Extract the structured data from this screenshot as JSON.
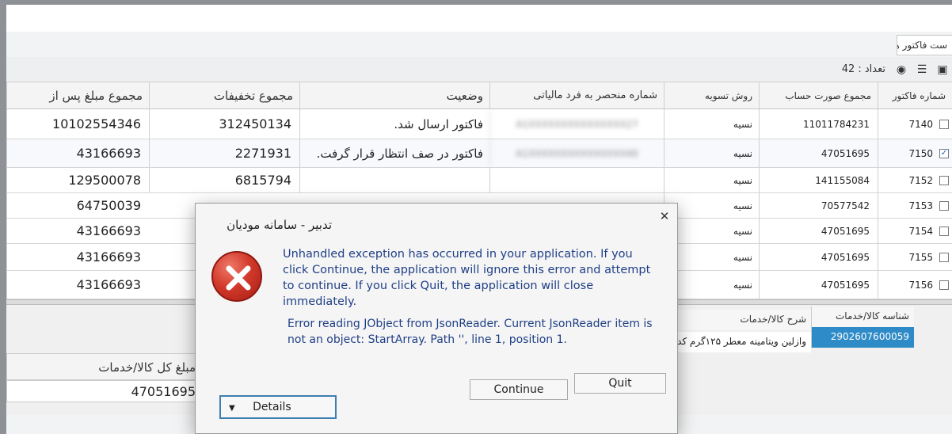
{
  "window": {
    "panel_tab": "ست فاکتور ها"
  },
  "toolbar": {
    "count_label": "تعداد : 42"
  },
  "grid": {
    "columns": {
      "invoice_no": "شماره فاکتور",
      "invoice_total": "مجموع صورت حساب",
      "settlement": "روش تسویه",
      "unique_tax_id": "شماره منحصر به فرد مالیاتی",
      "status": "وضعیت",
      "discounts": "مجموع تخفیفات",
      "after_discount": "مجموع مبلغ پس از"
    },
    "rows": [
      {
        "invoice_no": "7140",
        "checked": false,
        "invoice_total": "11011784231",
        "settlement": "نسیه",
        "tax_id": "A1XXXXXXXXXXXXXXX27",
        "status": "فاکتور ارسال شد.",
        "discounts": "312450134",
        "after_discount": "10102554346"
      },
      {
        "invoice_no": "7150",
        "checked": true,
        "invoice_total": "47051695",
        "settlement": "نسیه",
        "tax_id": "A1XXXXXXXXXXXXXXX40",
        "status": "فاکتور در صف انتظار قرار گرفت.",
        "discounts": "2271931",
        "after_discount": "43166693"
      },
      {
        "invoice_no": "7152",
        "checked": false,
        "invoice_total": "141155084",
        "settlement": "نسیه",
        "tax_id": "",
        "status": "",
        "discounts": "6815794",
        "after_discount": "129500078"
      },
      {
        "invoice_no": "7153",
        "checked": false,
        "invoice_total": "70577542",
        "settlement": "نسیه",
        "tax_id": "",
        "status": "",
        "discounts": "",
        "after_discount": "64750039"
      },
      {
        "invoice_no": "7154",
        "checked": false,
        "invoice_total": "47051695",
        "settlement": "نسیه",
        "tax_id": "",
        "status": "",
        "discounts": "",
        "after_discount": "43166693"
      },
      {
        "invoice_no": "7155",
        "checked": false,
        "invoice_total": "47051695",
        "settlement": "نسیه",
        "tax_id": "",
        "status": "",
        "discounts": "",
        "after_discount": "43166693"
      },
      {
        "invoice_no": "7156",
        "checked": false,
        "invoice_total": "47051695",
        "settlement": "نسیه",
        "tax_id": "",
        "status": "",
        "discounts": "",
        "after_discount": "43166693"
      }
    ]
  },
  "goods": {
    "col_id": "شناسه کالا/خدمات",
    "col_desc": "شرح کالا/خدمات",
    "row_id": "2902607600059",
    "row_desc": "وازلین ویتامینه معطر ۱۲۵گرم کد",
    "total_label": "مبلغ کل کالا/خدمات",
    "total_value": "47051695"
  },
  "dialog": {
    "title": "تدبیر - سامانه مودیان",
    "message": "Unhandled exception has occurred in your application. If you click Continue, the application will ignore this error and attempt to continue. If you click Quit, the application will close immediately.",
    "detail": "Error reading JObject from JsonReader. Current JsonReader item is not an object: StartArray. Path '', line 1, position 1.",
    "continue_label": "Continue",
    "quit_label": "Quit",
    "details_label": "Details"
  }
}
